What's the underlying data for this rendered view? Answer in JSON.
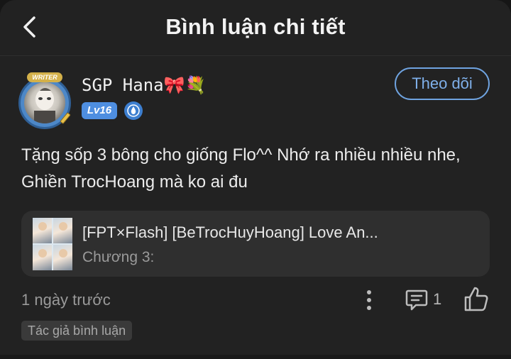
{
  "header": {
    "title": "Bình luận chi tiết"
  },
  "user": {
    "name": "SGP Hana🎀💐",
    "level": "Lv16",
    "avatar_frame_label": "WRITER",
    "follow_label": "Theo dõi"
  },
  "comment": {
    "text": "Tặng sốp 3 bông cho giống Flo^^ Nhớ ra nhiều nhiều nhe, Ghiền TrocHoang mà ko ai đu"
  },
  "story": {
    "title": "[FPT×Flash] [BeTrocHuyHoang] Love An...",
    "chapter": "Chương 3:"
  },
  "meta": {
    "time": "1 ngày trước",
    "reply_count": "1",
    "author_tag": "Tác giả bình luận"
  },
  "colors": {
    "background": "#222222",
    "accent": "#6fa3e0",
    "level_badge": "#4e8ee0",
    "card": "#2f2f2f"
  },
  "icons": {
    "back": "chevron-left-icon",
    "more": "more-vertical-icon",
    "reply": "comment-icon",
    "like": "thumbs-up-icon",
    "drop": "water-drop-icon"
  }
}
